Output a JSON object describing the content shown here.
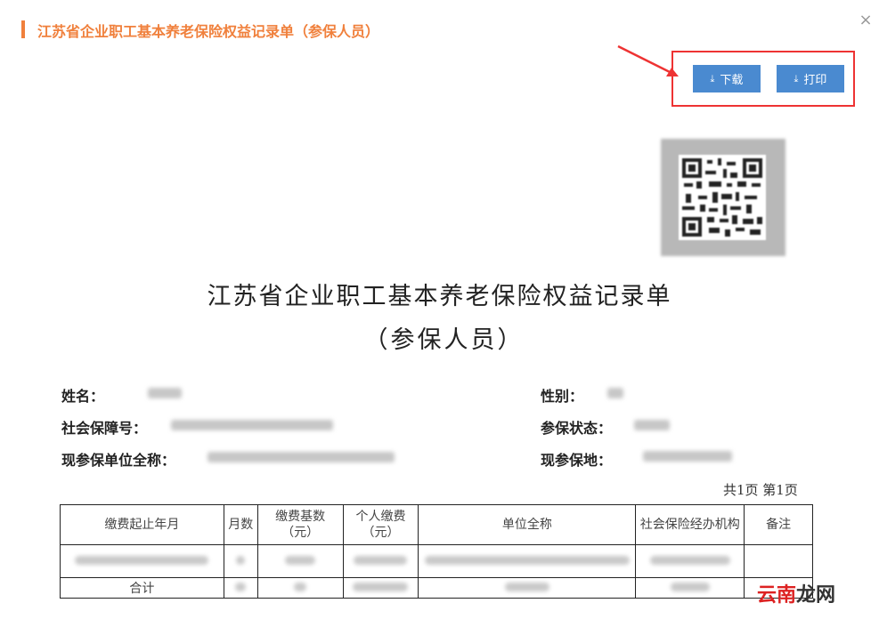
{
  "dialog": {
    "title": "江苏省企业职工基本养老保险权益记录单（参保人员）",
    "close_glyph": "×"
  },
  "toolbar": {
    "download_label": "下载",
    "print_label": "打印",
    "download_icon": "download-icon",
    "print_icon": "download-icon",
    "download_glyph": "⤓",
    "print_glyph": "⤓"
  },
  "document": {
    "title_line1": "江苏省企业职工基本养老保险权益记录单",
    "title_line2": "（参保人员）",
    "fields": {
      "name_label": "姓名：",
      "gender_label": "性别：",
      "ssn_label": "社会保障号：",
      "status_label": "参保状态：",
      "employer_label": "现参保单位全称：",
      "location_label": "现参保地："
    },
    "page_info": "共1页  第1页",
    "table": {
      "headers": [
        "缴费起止年月",
        "月数",
        "缴费基数\n（元）",
        "个人缴费\n（元）",
        "单位全称",
        "社会保险经办机构",
        "备注"
      ],
      "total_label": "合计"
    }
  },
  "watermark": {
    "part1": "云南",
    "part2": "龙网"
  },
  "colors": {
    "accent": "#f0803c",
    "button": "#4a8ad0",
    "highlight": "#e33333"
  }
}
